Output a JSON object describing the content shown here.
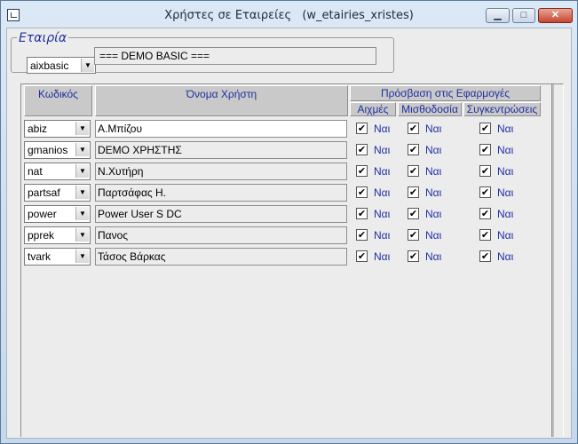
{
  "window": {
    "title": "Χρήστες σε Εταιρείες",
    "object_name": "(w_etairies_xristes)",
    "minimize_symbol": "▁",
    "maximize_symbol": "□",
    "close_symbol": "✕"
  },
  "company": {
    "group_label": "Εταιρία",
    "code": "aixbasic",
    "name": "=== DEMO BASIC ==="
  },
  "grid": {
    "headers": {
      "code": "Κωδικός",
      "user_name": "Όνομα Χρήστη",
      "access_group": "Πρόσβαση στις Εφαρμογές",
      "app1": "Αιχμές",
      "app2": "Μισθοδοσία",
      "app3": "Συγκεντρώσεις"
    },
    "rows": [
      {
        "code": "abiz",
        "name": "Α.Μπίζου",
        "app1": "Ναι",
        "app2": "Ναι",
        "app3": "Ναι"
      },
      {
        "code": "gmanios",
        "name": "DEMO ΧΡΗΣΤΗΣ",
        "app1": "Ναι",
        "app2": "Ναι",
        "app3": "Ναι"
      },
      {
        "code": "nat",
        "name": "Ν.Χυτήρη",
        "app1": "Ναι",
        "app2": "Ναι",
        "app3": "Ναι"
      },
      {
        "code": "partsaf",
        "name": "Παρτσάφας Η.",
        "app1": "Ναι",
        "app2": "Ναι",
        "app3": "Ναι"
      },
      {
        "code": "power",
        "name": "Power User S DC",
        "app1": "Ναι",
        "app2": "Ναι",
        "app3": "Ναι"
      },
      {
        "code": "pprek",
        "name": "Πανος",
        "app1": "Ναι",
        "app2": "Ναι",
        "app3": "Ναι"
      },
      {
        "code": "tvark",
        "name": "Τάσος Βάρκας",
        "app1": "Ναι",
        "app2": "Ναι",
        "app3": "Ναι"
      }
    ],
    "check_mark": "✔",
    "dropdown_arrow": "▼"
  }
}
